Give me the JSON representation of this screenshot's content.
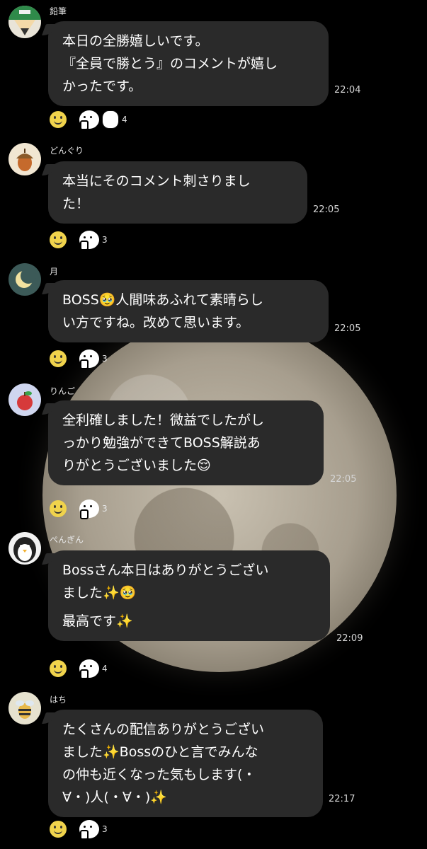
{
  "messages": [
    {
      "sender": "鉛筆",
      "avatar": "pencil-icon",
      "lines": [
        "本日の全勝嬉しいです。",
        "『全員で勝とう』のコメントが嬉し",
        "かったです。"
      ],
      "time": "22:04",
      "reaction_count": "4"
    },
    {
      "sender": "どんぐり",
      "avatar": "acorn-icon",
      "lines": [
        "本当にそのコメント刺さりまし",
        "た！"
      ],
      "time": "22:05",
      "reaction_count": "3"
    },
    {
      "sender": "月",
      "avatar": "moon-icon",
      "lines": [
        "BOSS🥹人間味あふれて素晴らし",
        "い方ですね。改めて思います。"
      ],
      "time": "22:05",
      "reaction_count": "3"
    },
    {
      "sender": "りんご",
      "avatar": "apple-icon",
      "lines": [
        "全利確しました！微益でしたがし",
        "っかり勉強ができてBOSS解説あ",
        "りがとうございました😌"
      ],
      "time": "22:05",
      "reaction_count": "3"
    },
    {
      "sender": "ぺんぎん",
      "avatar": "penguin-icon",
      "lines": [
        "Bossさん本日はありがとうござい",
        "ました✨🥹",
        "最高です✨"
      ],
      "time": "22:09",
      "reaction_count": "4"
    },
    {
      "sender": "はち",
      "avatar": "bee-icon",
      "lines": [
        "たくさんの配信ありがとうござい",
        "ました✨Bossのひと言でみんな",
        "の仲も近くなった気もします(・",
        "∀・)人(・∀・)✨"
      ],
      "time": "22:17",
      "reaction_count": "3"
    }
  ],
  "colors": {
    "background": "#000000",
    "bubble": "#2a2a2a",
    "text": "#ffffff"
  }
}
